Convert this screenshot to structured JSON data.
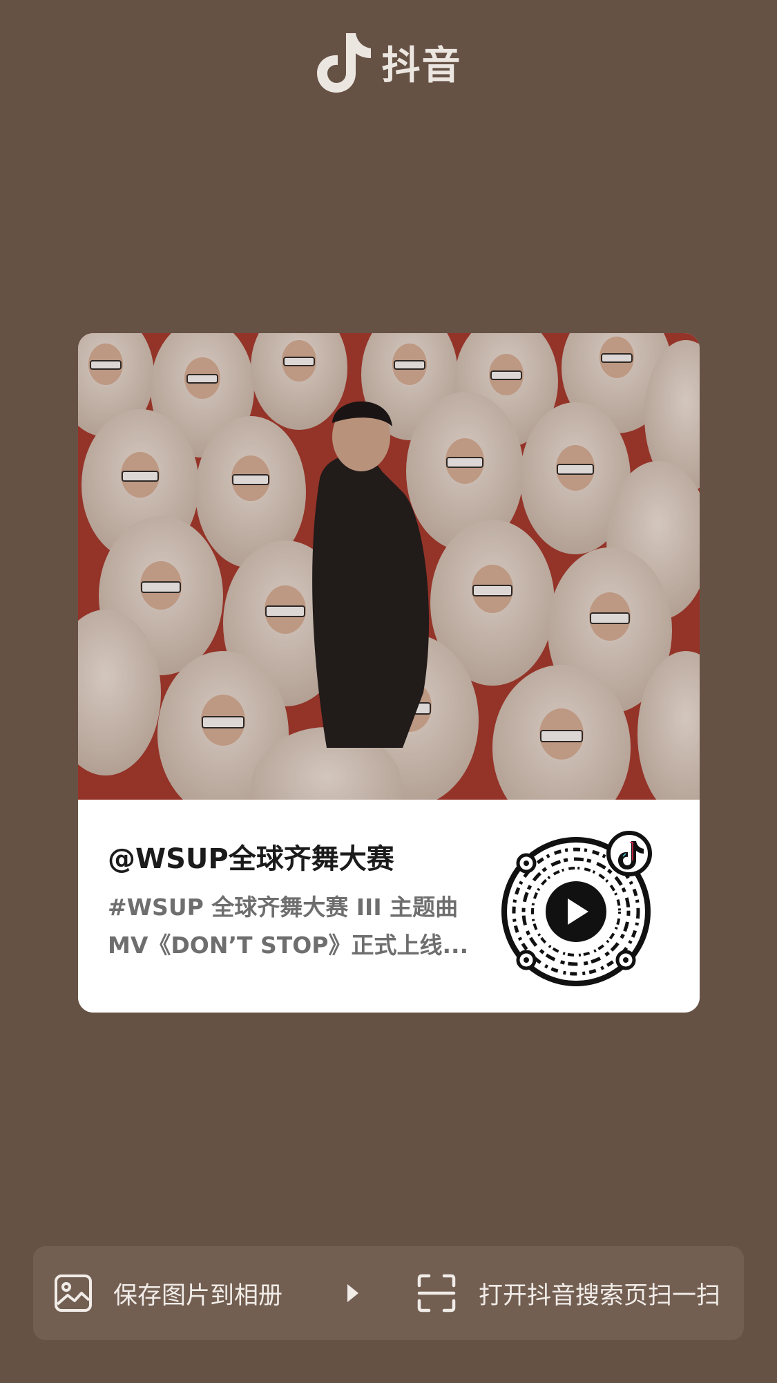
{
  "header": {
    "app_name": "抖音",
    "logo_icon": "douyin-note-icon"
  },
  "card": {
    "username": "@WSUP全球齐舞大赛",
    "description_line1": "#WSUP 全球齐舞大赛 III 主题曲",
    "description_line2": "MV《DON’T STOP》正式上线...",
    "qr_icon": "qr-code-with-play-icon"
  },
  "actions": {
    "save_label": "保存图片到相册",
    "save_icon": "image-icon",
    "arrow_icon": "play-triangle-icon",
    "scan_label": "打开抖音搜索页扫一扫",
    "scan_icon": "scan-frame-icon"
  },
  "colors": {
    "background": "#665245",
    "bar": "#735f52",
    "photo_backdrop": "#a8382d"
  }
}
